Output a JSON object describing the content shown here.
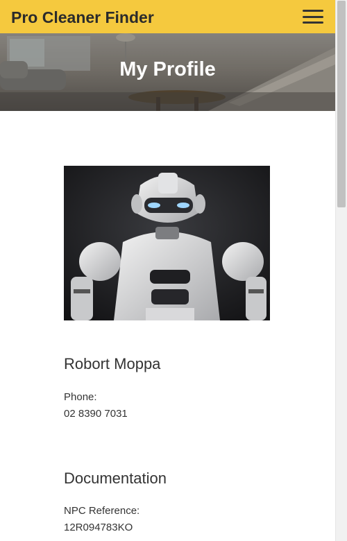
{
  "navbar": {
    "brand": "Pro Cleaner Finder",
    "menu_icon": "hamburger-menu-icon"
  },
  "hero": {
    "title": "My Profile"
  },
  "profile": {
    "name": "Robort Moppa",
    "phone_label": "Phone:",
    "phone_value": "02 8390 7031"
  },
  "documentation": {
    "heading": "Documentation",
    "npc_label": "NPC Reference:",
    "npc_value": "12R094783KO"
  },
  "colors": {
    "navbar": "#f5c93e",
    "text": "#333333"
  }
}
